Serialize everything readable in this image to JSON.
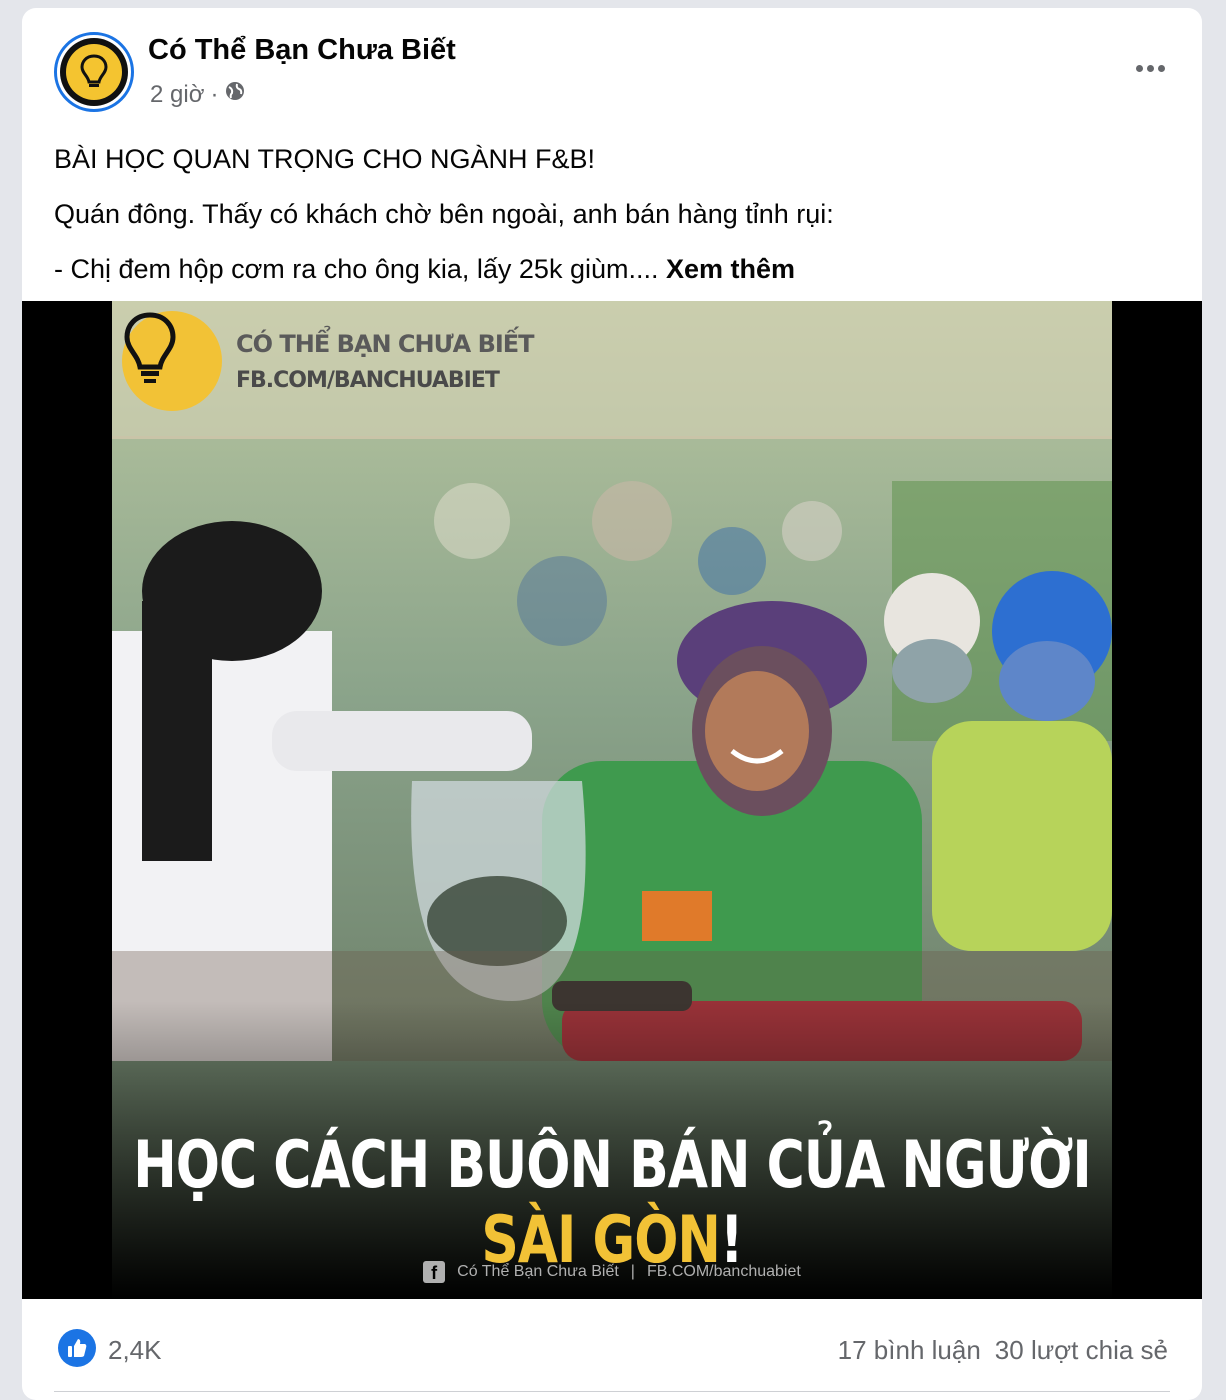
{
  "post": {
    "page_name": "Có Thể Bạn Chưa Biết",
    "time": "2 giờ",
    "separator": "·",
    "privacy_icon": "globe-icon",
    "text_lines": [
      "BÀI HỌC QUAN TRỌNG CHO NGÀNH F&B!",
      "Quán đông. Thấy có khách chờ bên ngoài, anh bán hàng tỉnh rụi:",
      "- Chị đem hộp cơm ra cho ông kia, lấy 25k giùm.... "
    ],
    "see_more": "Xem thêm"
  },
  "image": {
    "brand_title": "CÓ THỂ BẠN CHƯA BIẾT",
    "brand_url": "FB.COM/BANCHUABIET",
    "headline_main": "HỌC CÁCH BUÔN BÁN CỦA NGƯỜI ",
    "headline_accent": "SÀI GÒN",
    "headline_end": "!",
    "credit_page": "Có Thể Bạn Chưa Biết",
    "credit_sep": "|",
    "credit_url": "FB.COM/banchuabiet",
    "accent_color": "#f2c236"
  },
  "stats": {
    "reaction_icon": "like-icon",
    "reactions": "2,4K",
    "comments": "17 bình luận",
    "shares": "30 lượt chia sẻ"
  }
}
